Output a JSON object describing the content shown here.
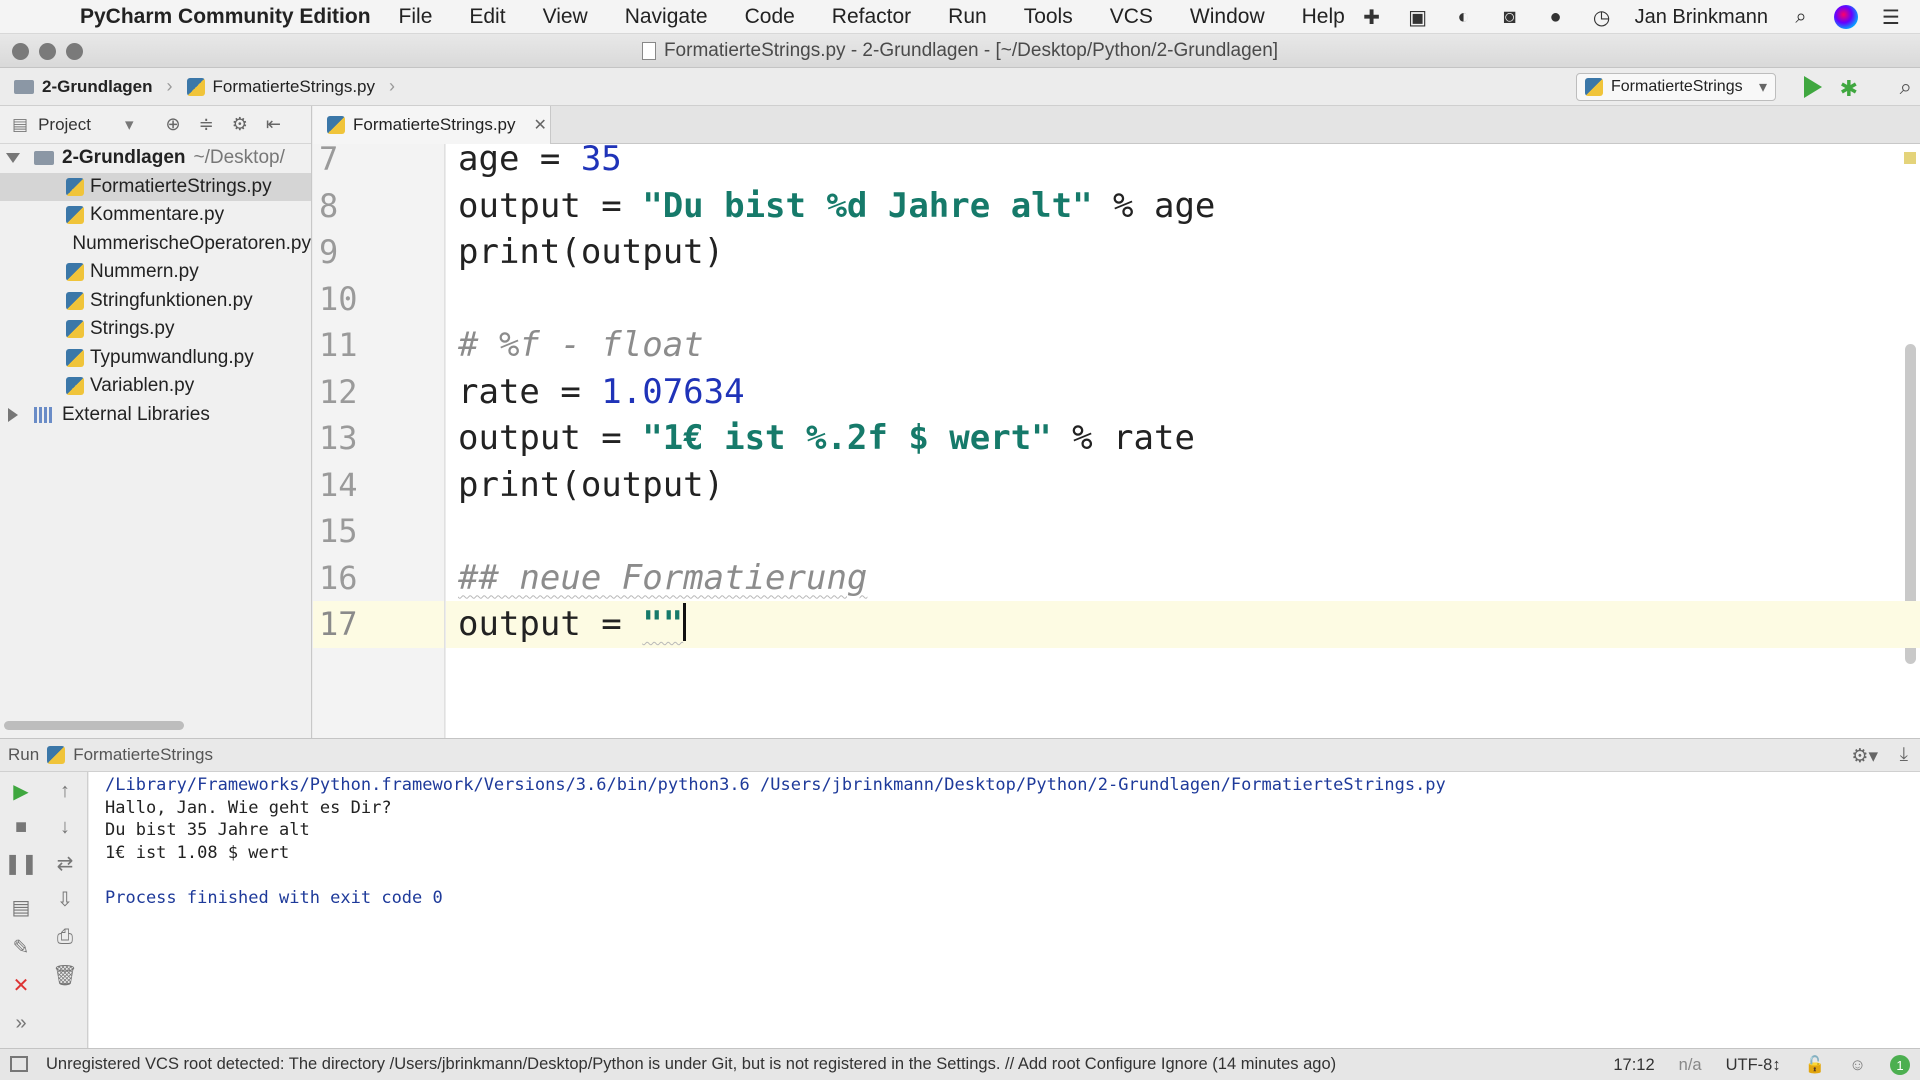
{
  "menubar": {
    "app_name": "PyCharm Community Edition",
    "menus": [
      "File",
      "Edit",
      "View",
      "Navigate",
      "Code",
      "Refactor",
      "Run",
      "Tools",
      "VCS",
      "Window",
      "Help"
    ],
    "user": "Jan Brinkmann",
    "tray_icons": [
      "plus-icon",
      "bag-icon",
      "leaf-icon",
      "camera-icon",
      "chat-icon",
      "clock-icon"
    ]
  },
  "window": {
    "title": "FormatierteStrings.py - 2-Grundlagen - [~/Desktop/Python/2-Grundlagen]"
  },
  "navbar": {
    "breadcrumb": [
      "2-Grundlagen",
      "FormatierteStrings.py"
    ],
    "run_config": "FormatierteStrings"
  },
  "project": {
    "label": "Project",
    "root": {
      "name": "2-Grundlagen",
      "path": "~/Desktop/"
    },
    "files": [
      "FormatierteStrings.py",
      "Kommentare.py",
      "NummerischeOperatoren.py",
      "Nummern.py",
      "Stringfunktionen.py",
      "Strings.py",
      "Typumwandlung.py",
      "Variablen.py"
    ],
    "selected_index": 0,
    "external": "External Libraries"
  },
  "editor": {
    "tab": "FormatierteStrings.py",
    "lines": [
      {
        "n": "7",
        "tokens": [
          [
            "age = ",
            ""
          ],
          [
            "35",
            "num"
          ]
        ]
      },
      {
        "n": "8",
        "tokens": [
          [
            "output = ",
            ""
          ],
          [
            "\"Du bist %d Jahre alt\"",
            "str"
          ],
          [
            " % age",
            ""
          ]
        ]
      },
      {
        "n": "9",
        "tokens": [
          [
            "print(output)",
            "fn"
          ]
        ]
      },
      {
        "n": "10",
        "tokens": []
      },
      {
        "n": "11",
        "tokens": [
          [
            "# %f - float",
            "comment"
          ]
        ]
      },
      {
        "n": "12",
        "tokens": [
          [
            "rate = ",
            ""
          ],
          [
            "1.07634",
            "num"
          ]
        ]
      },
      {
        "n": "13",
        "tokens": [
          [
            "output = ",
            ""
          ],
          [
            "\"1€ ist %.2f $ wert\"",
            "str"
          ],
          [
            " % rate",
            ""
          ]
        ]
      },
      {
        "n": "14",
        "tokens": [
          [
            "print(output)",
            "fn"
          ]
        ]
      },
      {
        "n": "15",
        "tokens": []
      },
      {
        "n": "16",
        "tokens": [
          [
            "## neue Formatierung",
            "comment-squiggle"
          ]
        ]
      },
      {
        "n": "17",
        "tokens": [
          [
            "output = ",
            ""
          ],
          [
            "\"\"",
            "str-squiggle"
          ]
        ],
        "current": true
      }
    ]
  },
  "run": {
    "label": "Run",
    "config": "FormatierteStrings",
    "output": [
      {
        "text": "/Library/Frameworks/Python.framework/Versions/3.6/bin/python3.6 /Users/jbrinkmann/Desktop/Python/2-Grundlagen/FormatierteStrings.py",
        "kind": "path"
      },
      {
        "text": "Hallo, Jan. Wie geht es Dir?",
        "kind": "out"
      },
      {
        "text": "Du bist 35 Jahre alt",
        "kind": "out"
      },
      {
        "text": "1€ ist 1.08 $ wert",
        "kind": "out"
      },
      {
        "text": "",
        "kind": "out"
      },
      {
        "text": "Process finished with exit code 0",
        "kind": "exit"
      }
    ]
  },
  "statusbar": {
    "message": "Unregistered VCS root detected: The directory /Users/jbrinkmann/Desktop/Python is under Git, but is not registered in the Settings. // Add root  Configure  Ignore (14 minutes ago)",
    "position": "17:12",
    "na": "n/a",
    "encoding": "UTF-8↕",
    "badge": "1"
  }
}
